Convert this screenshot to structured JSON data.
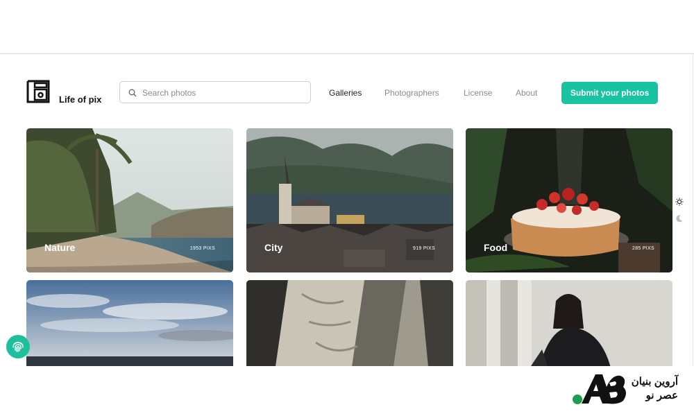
{
  "header": {
    "brand": "Life of pix",
    "search": {
      "placeholder": "Search photos",
      "value": ""
    },
    "nav": [
      "Galleries",
      "Photographers",
      "License",
      "About"
    ],
    "active_nav": "Galleries",
    "submit_label": "Submit your photos"
  },
  "galleries": [
    {
      "title": "Nature",
      "count": "1953 PIXS"
    },
    {
      "title": "City",
      "count": "919 PIXS"
    },
    {
      "title": "Food",
      "count": "285 PIXS"
    },
    {
      "title": "",
      "count": ""
    },
    {
      "title": "",
      "count": ""
    },
    {
      "title": "",
      "count": ""
    }
  ],
  "theme_toggle": {
    "light_icon": "sun-icon",
    "dark_icon": "moon-icon"
  },
  "watermark": {
    "line1": "آروین بنیان",
    "line2": "عصر نو"
  },
  "colors": {
    "accent": "#17c3a1",
    "fingerprint_button": "#1dbf9c",
    "watermark_dot": "#1e9e4a"
  }
}
